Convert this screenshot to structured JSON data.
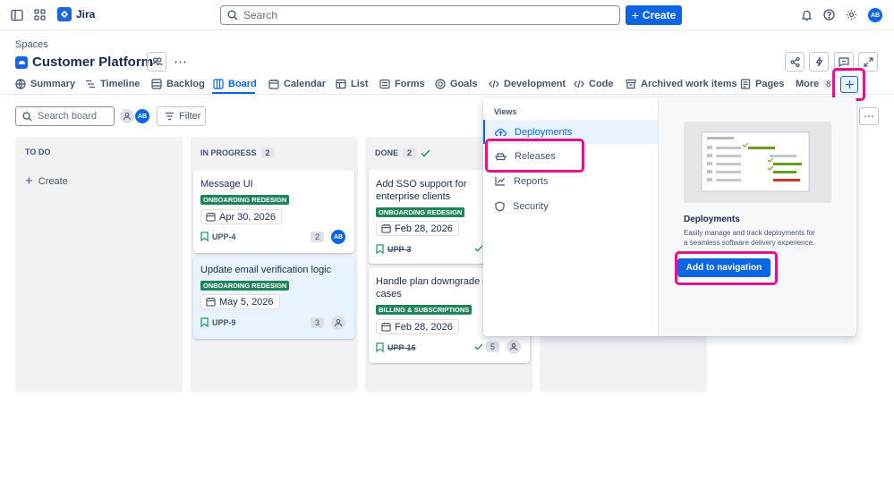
{
  "topbar": {
    "app_name": "Jira",
    "search_placeholder": "Search",
    "create_label": "Create",
    "user_initials": "AB"
  },
  "header": {
    "breadcrumb": "Spaces",
    "project_title": "Customer Platform"
  },
  "tabs": [
    {
      "label": "Summary",
      "icon": "globe-icon"
    },
    {
      "label": "Timeline",
      "icon": "timeline-icon"
    },
    {
      "label": "Backlog",
      "icon": "backlog-icon"
    },
    {
      "label": "Board",
      "icon": "board-icon",
      "active": true
    },
    {
      "label": "Calendar",
      "icon": "calendar-icon"
    },
    {
      "label": "List",
      "icon": "list-icon"
    },
    {
      "label": "Forms",
      "icon": "forms-icon"
    },
    {
      "label": "Goals",
      "icon": "goals-icon"
    },
    {
      "label": "Development",
      "icon": "development-icon"
    },
    {
      "label": "Code",
      "icon": "code-icon"
    },
    {
      "label": "Archived work items",
      "icon": "archive-icon"
    },
    {
      "label": "Pages",
      "icon": "pages-icon"
    }
  ],
  "more_tab": {
    "label": "More",
    "count": "8"
  },
  "toolbar": {
    "search_board_placeholder": "Search board",
    "filter_label": "Filter",
    "avatar_initials": "AB"
  },
  "columns": [
    {
      "title": "TO DO",
      "count": "",
      "create_label": "Create"
    },
    {
      "title": "IN PROGRESS",
      "count": "2"
    },
    {
      "title": "DONE",
      "count": "2"
    }
  ],
  "cards": [
    {
      "title": "Message UI",
      "epic": "ONBOARDING REDESIGN",
      "date": "Apr 30, 2026",
      "key": "UPP-4",
      "estimate": "2",
      "assignee": "AB"
    },
    {
      "title": "Update email verification logic",
      "epic": "ONBOARDING REDESIGN",
      "date": "May 5, 2026",
      "key": "UPP-9",
      "estimate": "3",
      "assignee": ""
    },
    {
      "title_line1": "Add SSO support for",
      "title_line2": "enterprise clients",
      "epic": "ONBOARDING REDESIGN",
      "date": "Feb 28, 2026",
      "key": "UPP-3"
    },
    {
      "title_line1": "Handle plan downgrade ed",
      "title_line2": "cases",
      "epic": "BILLING & SUBSCRIPTIONS",
      "date": "Feb 28, 2026",
      "key": "UPP-16",
      "estimate": "5"
    }
  ],
  "dropdown": {
    "section_label": "Views",
    "items": [
      {
        "label": "Deployments",
        "icon": "cloud-upload-icon",
        "active": true
      },
      {
        "label": "Releases",
        "icon": "ship-icon"
      },
      {
        "label": "Reports",
        "icon": "chart-line-icon"
      },
      {
        "label": "Security",
        "icon": "shield-icon"
      }
    ],
    "preview_title": "Deployments",
    "preview_desc_line1": "Easily manage and track deployments for",
    "preview_desc_line2": "a seamless software delivery experience.",
    "add_button_label": "Add to navigation"
  },
  "colors": {
    "accent": "#0c66e4",
    "highlight": "#e0148b",
    "lozenge_green": "#1f845a"
  }
}
